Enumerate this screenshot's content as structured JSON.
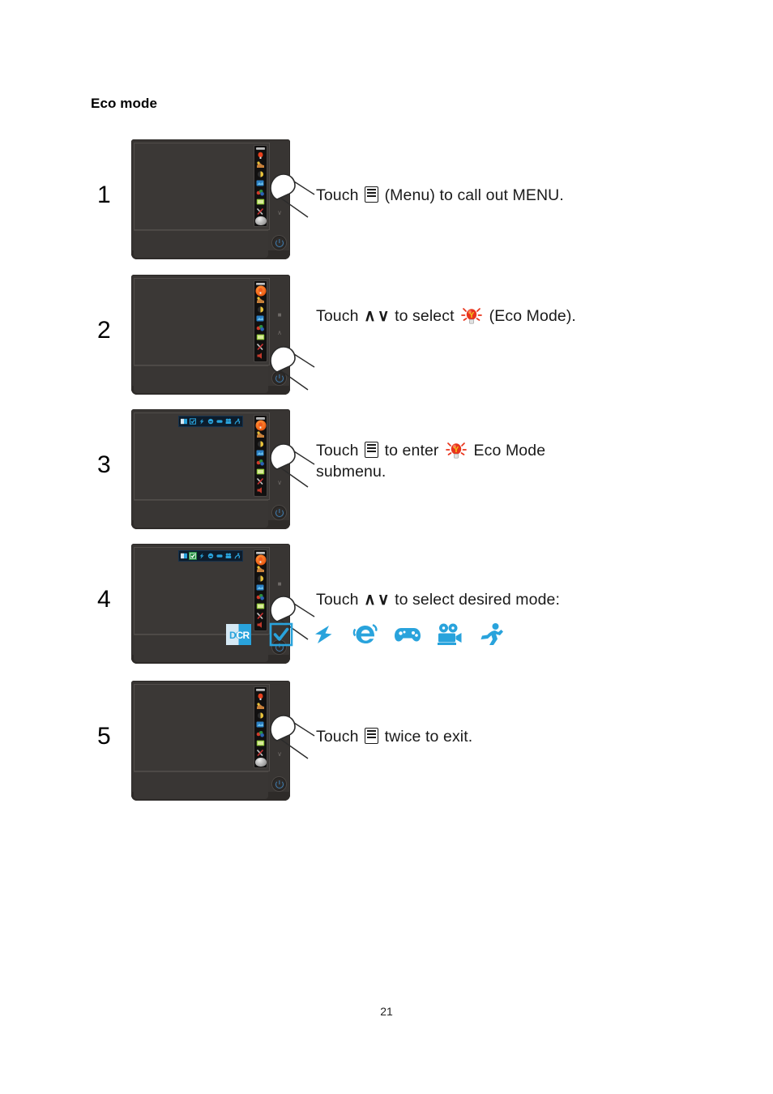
{
  "document": {
    "section_title": "Eco mode",
    "page_number": "21"
  },
  "colors": {
    "accent_blue": "#29A3DC",
    "eco_bulb_red": "#E8341C",
    "eco_bulb_yellow": "#F5C518",
    "osd_highlight_orange": "#F2661A",
    "submenu_highlight_green": "#1F8A3C",
    "monitor_body": "#383533",
    "monitor_screen": "#3B3836",
    "power_led_blue": "#3F7FB5"
  },
  "steps": [
    {
      "number": "1",
      "text_lines": [
        "Touch [menu-icon] (Menu) to  call out MENU."
      ],
      "segments": [
        {
          "type": "text",
          "value": "Touch "
        },
        {
          "type": "icon",
          "value": "menu-icon"
        },
        {
          "type": "text",
          "value": " (Menu) to  call out MENU."
        }
      ],
      "monitor": {
        "osd_open": true,
        "osd_selected_index": -1,
        "submenu_open": false,
        "submenu_highlight_index": -1,
        "osd_last_is_ball": true,
        "finger_target": "menu-button"
      }
    },
    {
      "number": "2",
      "text_lines": [
        "Touch ∧ ∨ to select [eco-icon] (Eco Mode)."
      ],
      "segments": [
        {
          "type": "text",
          "value": "Touch "
        },
        {
          "type": "glyph",
          "value": "∧"
        },
        {
          "type": "glyph",
          "value": "∨"
        },
        {
          "type": "text",
          "value": " to select "
        },
        {
          "type": "icon",
          "value": "eco-bulb-icon"
        },
        {
          "type": "text",
          "value": " (Eco Mode)."
        }
      ],
      "monitor": {
        "osd_open": true,
        "osd_selected_index": 0,
        "submenu_open": false,
        "submenu_highlight_index": -1,
        "osd_last_is_ball": false,
        "finger_target": "down-button"
      }
    },
    {
      "number": "3",
      "text_lines": [
        "Touch [menu-icon] to enter [eco-icon] Eco Mode",
        "submenu."
      ],
      "segments": [
        {
          "type": "text",
          "value": "Touch "
        },
        {
          "type": "icon",
          "value": "menu-icon"
        },
        {
          "type": "text",
          "value": " to enter "
        },
        {
          "type": "icon",
          "value": "eco-bulb-icon"
        },
        {
          "type": "text",
          "value": " Eco Mode"
        },
        {
          "type": "break",
          "value": ""
        },
        {
          "type": "text",
          "value": "submenu."
        }
      ],
      "monitor": {
        "osd_open": true,
        "osd_selected_index": 0,
        "submenu_open": true,
        "submenu_highlight_index": -1,
        "osd_last_is_ball": false,
        "finger_target": "menu-button"
      }
    },
    {
      "number": "4",
      "text_lines": [
        "Touch ∧ ∨ to select desired  mode:"
      ],
      "segments": [
        {
          "type": "text",
          "value": "Touch "
        },
        {
          "type": "glyph",
          "value": "∧"
        },
        {
          "type": "glyph",
          "value": "∨"
        },
        {
          "type": "text",
          "value": " to select desired  mode:"
        }
      ],
      "monitor": {
        "osd_open": true,
        "osd_selected_index": 0,
        "submenu_open": true,
        "submenu_highlight_index": 1,
        "osd_last_is_ball": false,
        "finger_target": "down-button"
      }
    },
    {
      "number": "5",
      "text_lines": [
        "Touch [menu-icon] twice to exit."
      ],
      "segments": [
        {
          "type": "text",
          "value": "Touch "
        },
        {
          "type": "icon",
          "value": "menu-icon"
        },
        {
          "type": "text",
          "value": " twice to exit."
        }
      ],
      "monitor": {
        "osd_open": true,
        "osd_selected_index": -1,
        "submenu_open": false,
        "submenu_highlight_index": -1,
        "osd_last_is_ball": true,
        "finger_target": "menu-button"
      }
    }
  ],
  "eco_modes": [
    {
      "name": "dcr-icon",
      "label": "DCR"
    },
    {
      "name": "standard-check-icon",
      "label": "Standard"
    },
    {
      "name": "text-bolt-icon",
      "label": "Text"
    },
    {
      "name": "internet-e-icon",
      "label": "Internet"
    },
    {
      "name": "game-controller-icon",
      "label": "Game"
    },
    {
      "name": "movie-camera-icon",
      "label": "Movie"
    },
    {
      "name": "sports-runner-icon",
      "label": "Sports"
    }
  ],
  "osd_menu_items": [
    {
      "name": "eco-mode-menu-icon"
    },
    {
      "name": "brightness-contrast-menu-icon"
    },
    {
      "name": "color-setup-menu-icon"
    },
    {
      "name": "picture-boost-menu-icon"
    },
    {
      "name": "osd-setup-menu-icon"
    },
    {
      "name": "image-setup-menu-icon"
    },
    {
      "name": "extra-menu-icon"
    },
    {
      "name": "exit-menu-icon"
    }
  ],
  "monitor_controls": [
    {
      "name": "menu-button"
    },
    {
      "name": "up-button"
    },
    {
      "name": "down-button"
    },
    {
      "name": "power-button"
    }
  ]
}
